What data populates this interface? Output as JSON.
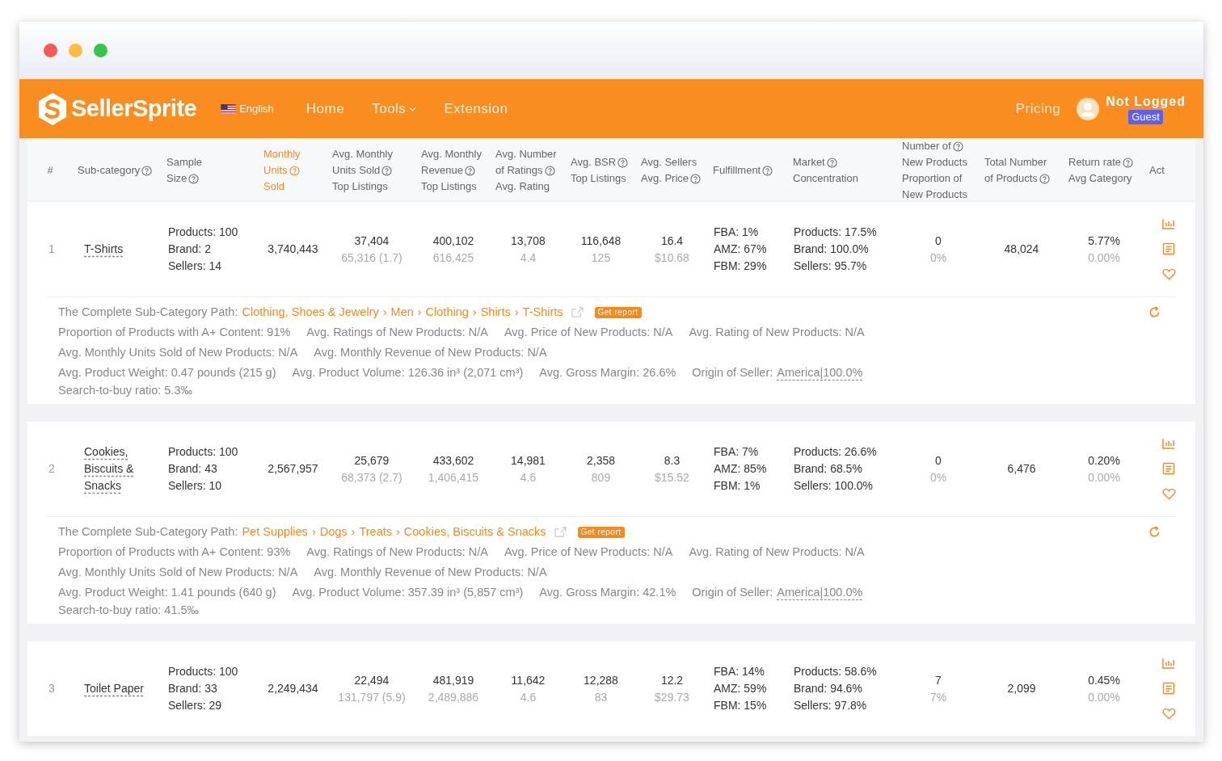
{
  "nav": {
    "brand": "SellerSprite",
    "language": "English",
    "links": [
      {
        "label": "Home",
        "kind": "plain"
      },
      {
        "label": "Tools",
        "kind": "dropdown"
      },
      {
        "label": "Extension",
        "kind": "plain"
      }
    ],
    "pricing": "Pricing",
    "user": {
      "name": "Not Logged",
      "badge": "Guest"
    }
  },
  "table": {
    "columns": [
      {
        "lines": [
          {
            "text": "#",
            "help": false
          }
        ],
        "selected": false
      },
      {
        "lines": [
          {
            "text": "Sub-category",
            "help": true
          }
        ],
        "selected": false
      },
      {
        "lines": [
          {
            "text": "Sample",
            "help": false
          },
          {
            "text": "Size",
            "help": true
          }
        ],
        "selected": false
      },
      {
        "lines": [
          {
            "text": "Monthly",
            "help": false
          },
          {
            "text": "Units",
            "help": true
          },
          {
            "text": "Sold",
            "help": false
          }
        ],
        "selected": true
      },
      {
        "lines": [
          {
            "text": "Avg. Monthly",
            "help": false
          },
          {
            "text": "Units Sold",
            "help": true
          },
          {
            "text": "Top Listings",
            "help": false
          }
        ],
        "selected": false
      },
      {
        "lines": [
          {
            "text": "Avg. Monthly",
            "help": false
          },
          {
            "text": "Revenue",
            "help": true
          },
          {
            "text": "Top Listings",
            "help": false
          }
        ],
        "selected": false
      },
      {
        "lines": [
          {
            "text": "Avg. Number",
            "help": false
          },
          {
            "text": "of Ratings",
            "help": true
          },
          {
            "text": "Avg. Rating",
            "help": false
          }
        ],
        "selected": false
      },
      {
        "lines": [
          {
            "text": "Avg. BSR",
            "help": true
          },
          {
            "text": "Top Listings",
            "help": false
          }
        ],
        "selected": false
      },
      {
        "lines": [
          {
            "text": "Avg. Sellers",
            "help": false
          },
          {
            "text": "Avg. Price",
            "help": true
          }
        ],
        "selected": false
      },
      {
        "lines": [
          {
            "text": "Fulfillment",
            "help": true
          }
        ],
        "selected": false
      },
      {
        "lines": [
          {
            "text": "Market",
            "help": true
          },
          {
            "text": "Concentration",
            "help": false
          }
        ],
        "selected": false
      },
      {
        "lines": [
          {
            "text": "Number of",
            "help": true
          },
          {
            "text": "New Products",
            "help": false
          },
          {
            "text": "Proportion of",
            "help": false
          },
          {
            "text": "New Products",
            "help": false
          }
        ],
        "selected": false
      },
      {
        "lines": [
          {
            "text": "Total Number",
            "help": false
          },
          {
            "text": "of Products",
            "help": true
          }
        ],
        "selected": false
      },
      {
        "lines": [
          {
            "text": "Return rate",
            "help": true
          },
          {
            "text": "Avg Category",
            "help": false
          }
        ],
        "selected": false
      },
      {
        "lines": [
          {
            "text": "Act",
            "help": false
          }
        ],
        "selected": false
      }
    ],
    "rows": [
      {
        "index": "1",
        "name": "T-Shirts",
        "sample": [
          "Products: 100",
          "Brand: 2",
          "Sellers: 14"
        ],
        "units": "3,740,443",
        "avg_units": [
          "37,404",
          "65,316 (1.7)"
        ],
        "revenue": [
          "400,102",
          "616,425"
        ],
        "ratings": [
          "13,708",
          "4.4"
        ],
        "bsr": [
          "116,648",
          "125"
        ],
        "sellers": [
          "16.4",
          "$10.68"
        ],
        "fulfillment": [
          "FBA: 1%",
          "AMZ: 67%",
          "FBM: 29%"
        ],
        "market": [
          "Products: 17.5%",
          "Brand: 100.0%",
          "Sellers: 95.7%"
        ],
        "new_products": [
          "0",
          "0%"
        ],
        "total": "48,024",
        "return_rate": [
          "5.77%",
          "0.00%"
        ],
        "details": {
          "path_label": "The Complete Sub-Category Path:",
          "separator": "›",
          "path": [
            "Clothing, Shoes & Jewelry",
            "Men",
            "Clothing",
            "Shirts",
            "T-Shirts"
          ],
          "report": "Get report",
          "lines": [
            [
              {
                "kind": "text",
                "text": "Proportion of Products with A+ Content: 91%"
              },
              {
                "kind": "text",
                "text": "Avg. Ratings of New Products: N/A"
              },
              {
                "kind": "text",
                "text": "Avg. Price of New Products: N/A"
              },
              {
                "kind": "text",
                "text": "Avg. Rating of New Products: N/A"
              }
            ],
            [
              {
                "kind": "text",
                "text": "Avg. Monthly Units Sold of New Products: N/A"
              },
              {
                "kind": "text",
                "text": "Avg. Monthly Revenue of New Products: N/A"
              }
            ],
            [
              {
                "kind": "text",
                "text": "Avg. Product Weight: 0.47 pounds (215 g)"
              },
              {
                "kind": "text",
                "text": "Avg. Product Volume: 126.36 in³ (2,071 cm³)"
              },
              {
                "kind": "text",
                "text": "Avg. Gross Margin: 26.6%"
              },
              {
                "kind": "underlined",
                "text": "Origin of Seller:",
                "value": "America|100.0%"
              }
            ],
            [
              {
                "kind": "text",
                "text": "Search-to-buy ratio: 5.3‰"
              }
            ]
          ]
        }
      },
      {
        "index": "2",
        "name": "Cookies, Biscuits & Snacks",
        "sample": [
          "Products: 100",
          "Brand: 43",
          "Sellers: 10"
        ],
        "units": "2,567,957",
        "avg_units": [
          "25,679",
          "68,373 (2.7)"
        ],
        "revenue": [
          "433,602",
          "1,406,415"
        ],
        "ratings": [
          "14,981",
          "4.6"
        ],
        "bsr": [
          "2,358",
          "809"
        ],
        "sellers": [
          "8.3",
          "$15.52"
        ],
        "fulfillment": [
          "FBA: 7%",
          "AMZ: 85%",
          "FBM: 1%"
        ],
        "market": [
          "Products: 26.6%",
          "Brand: 68.5%",
          "Sellers: 100.0%"
        ],
        "new_products": [
          "0",
          "0%"
        ],
        "total": "6,476",
        "return_rate": [
          "0.20%",
          "0.00%"
        ],
        "details": {
          "path_label": "The Complete Sub-Category Path:",
          "separator": "›",
          "path": [
            "Pet Supplies",
            "Dogs",
            "Treats",
            "Cookies, Biscuits & Snacks"
          ],
          "report": "Get report",
          "lines": [
            [
              {
                "kind": "text",
                "text": "Proportion of Products with A+ Content: 93%"
              },
              {
                "kind": "text",
                "text": "Avg. Ratings of New Products: N/A"
              },
              {
                "kind": "text",
                "text": "Avg. Price of New Products: N/A"
              },
              {
                "kind": "text",
                "text": "Avg. Rating of New Products: N/A"
              }
            ],
            [
              {
                "kind": "text",
                "text": "Avg. Monthly Units Sold of New Products: N/A"
              },
              {
                "kind": "text",
                "text": "Avg. Monthly Revenue of New Products: N/A"
              }
            ],
            [
              {
                "kind": "text",
                "text": "Avg. Product Weight: 1.41 pounds (640 g)"
              },
              {
                "kind": "text",
                "text": "Avg. Product Volume: 357.39 in³ (5,857 cm³)"
              },
              {
                "kind": "text",
                "text": "Avg. Gross Margin: 42.1%"
              },
              {
                "kind": "underlined",
                "text": "Origin of Seller:",
                "value": "America|100.0%"
              }
            ],
            [
              {
                "kind": "text",
                "text": "Search-to-buy ratio: 41.5‰"
              }
            ]
          ]
        }
      },
      {
        "index": "3",
        "name": "Toilet Paper",
        "sample": [
          "Products: 100",
          "Brand: 33",
          "Sellers: 29"
        ],
        "units": "2,249,434",
        "avg_units": [
          "22,494",
          "131,797 (5.9)"
        ],
        "revenue": [
          "481,919",
          "2,489,886"
        ],
        "ratings": [
          "11,642",
          "4.6"
        ],
        "bsr": [
          "12,288",
          "83"
        ],
        "sellers": [
          "12.2",
          "$29.73"
        ],
        "fulfillment": [
          "FBA: 14%",
          "AMZ: 59%",
          "FBM: 15%"
        ],
        "market": [
          "Products: 58.6%",
          "Brand: 94.6%",
          "Sellers: 97.8%"
        ],
        "new_products": [
          "7",
          "7%"
        ],
        "total": "2,099",
        "return_rate": [
          "0.45%",
          "0.00%"
        ]
      }
    ]
  }
}
